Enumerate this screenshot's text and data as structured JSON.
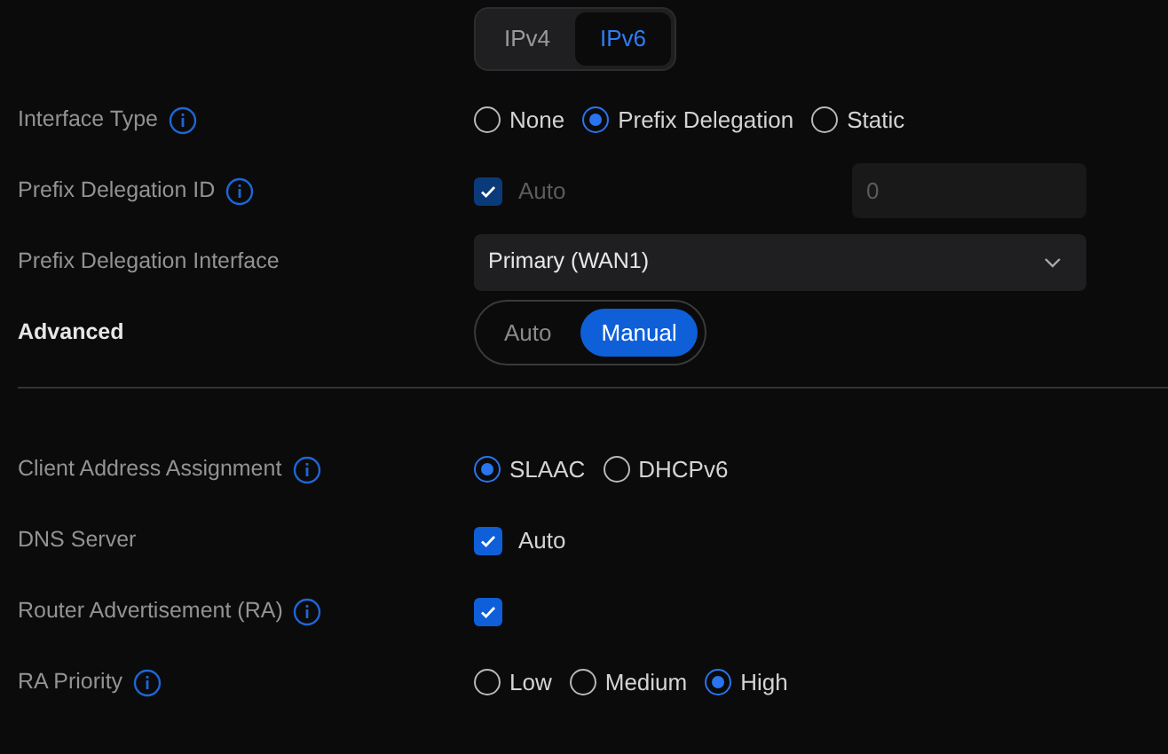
{
  "ip_tabs": [
    {
      "label": "IPv4",
      "selected": false
    },
    {
      "label": "IPv6",
      "selected": true
    }
  ],
  "sections": [
    {
      "rows": [
        {
          "kind": "radio",
          "label": "Interface Type",
          "info": true,
          "options": [
            {
              "label": "None",
              "selected": false
            },
            {
              "label": "Prefix Delegation",
              "selected": true
            },
            {
              "label": "Static",
              "selected": false
            }
          ]
        },
        {
          "kind": "checkbox",
          "label": "Prefix Delegation ID",
          "info": true,
          "options": [
            {
              "label": "Auto",
              "checked": true,
              "disabled": true
            }
          ],
          "field": {
            "value": "0",
            "disabled": true
          }
        },
        {
          "kind": "select",
          "label": "Prefix Delegation Interface",
          "info": false,
          "value": "Primary (WAN1)"
        },
        {
          "kind": "segmented",
          "label": "Advanced",
          "info": false,
          "options": [
            {
              "label": "Auto",
              "selected": false
            },
            {
              "label": "Manual",
              "selected": true
            }
          ]
        }
      ]
    },
    {
      "rows": [
        {
          "kind": "radio",
          "label": "Client Address Assignment",
          "info": true,
          "options": [
            {
              "label": "SLAAC",
              "selected": true
            },
            {
              "label": "DHCPv6",
              "selected": false
            }
          ]
        },
        {
          "kind": "checkbox",
          "label": "DNS Server",
          "info": false,
          "options": [
            {
              "label": "Auto",
              "checked": true,
              "disabled": false
            }
          ]
        },
        {
          "kind": "checkbox",
          "label": "Router Advertisement (RA)",
          "info": true,
          "options": [
            {
              "checked": true,
              "disabled": false
            }
          ]
        },
        {
          "kind": "radio",
          "label": "RA Priority",
          "info": true,
          "options": [
            {
              "label": "Low",
              "selected": false
            },
            {
              "label": "Medium",
              "selected": false
            },
            {
              "label": "High",
              "selected": true
            }
          ]
        }
      ]
    }
  ]
}
